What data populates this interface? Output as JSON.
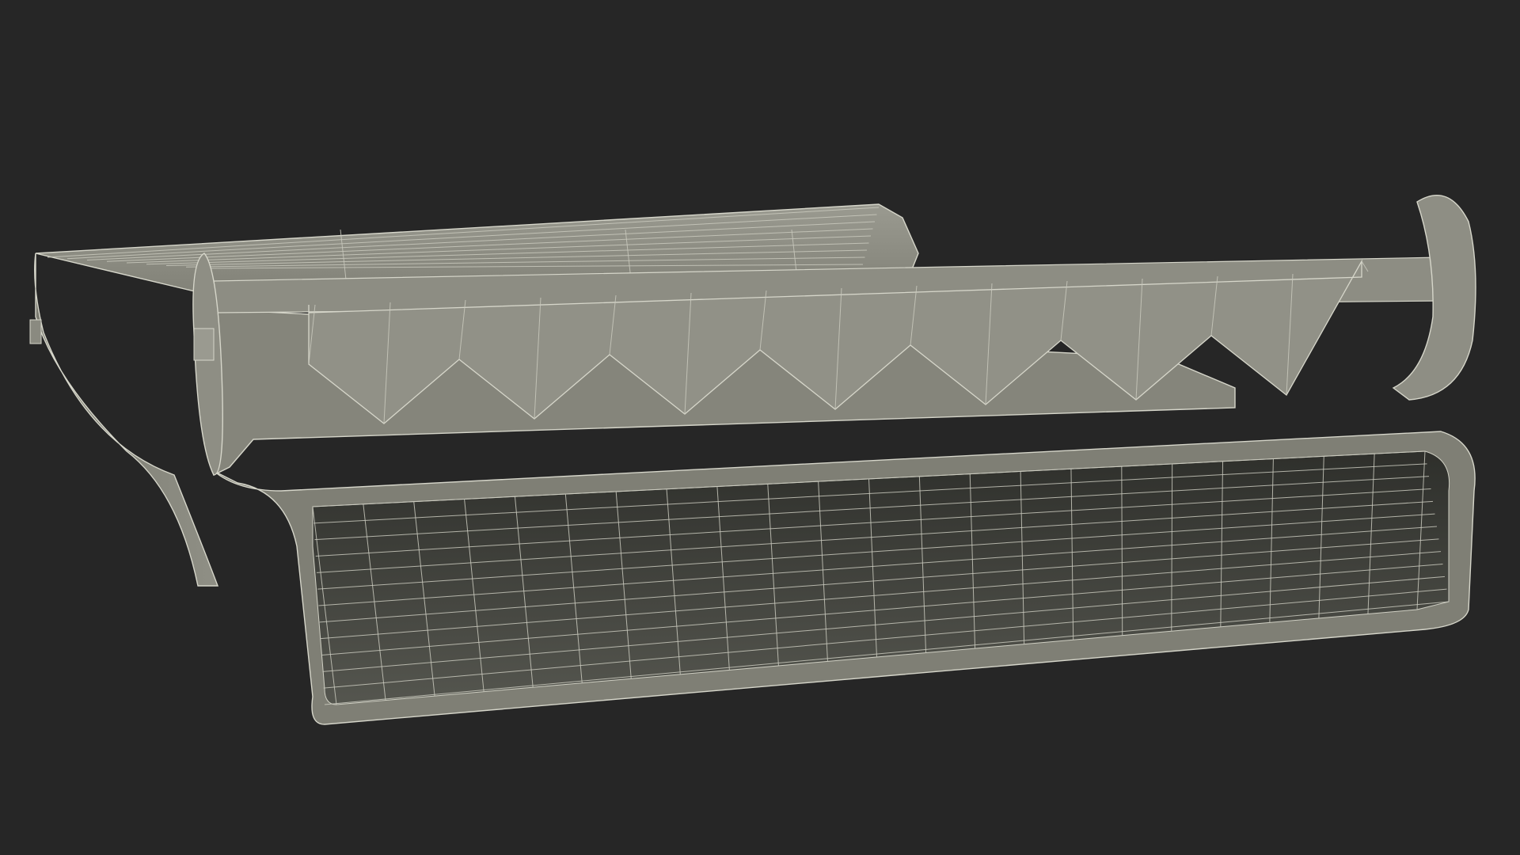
{
  "viewport": {
    "background_color": "#262626",
    "render_mode": "wireframe-on-shaded",
    "mesh_face_color": "#8a8a80",
    "mesh_dark_face_color": "#44453f",
    "wire_color": "#d6d6ca"
  },
  "model": {
    "component_names": [
      "lower-tray",
      "upper-lid",
      "toothed-bar",
      "left-end-disc",
      "right-end-disc",
      "hinge-rod"
    ]
  }
}
